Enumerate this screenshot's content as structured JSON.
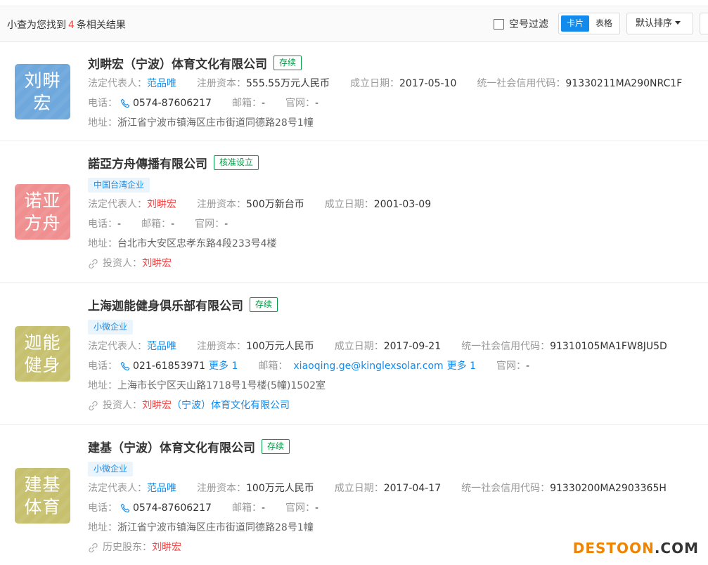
{
  "toolbar": {
    "result_prefix": "小查为您找到",
    "result_count": "4",
    "result_suffix": "条相关结果",
    "empty_filter_label": "空号过滤",
    "view_card_label": "卡片",
    "view_table_label": "表格",
    "sort_label": "默认排序"
  },
  "labels": {
    "legal_rep": "法定代表人：",
    "capital": "注册资本：",
    "founded": "成立日期：",
    "credit_code": "统一社会信用代码：",
    "phone": "电话：",
    "email": "邮箱：",
    "website": "官网：",
    "address": "地址：",
    "investor": "投资人：",
    "history_shareholder": "历史股东："
  },
  "results": [
    {
      "logo_line1": "刘畊",
      "logo_line2": "宏",
      "logo_color": "#6fa8dc",
      "name_highlight": "刘畊宏",
      "name_rest": "（宁波）体育文化有限公司",
      "status": "存续",
      "legal_rep": "范品唯",
      "capital": "555.55万元人民币",
      "founded": "2017-05-10",
      "credit_code": "91330211MA290NRC1F",
      "phone": "0574-87606217",
      "email": "-",
      "website": "-",
      "address": "浙江省宁波市镇海区庄市街道同德路28号1幢"
    },
    {
      "logo_line1": "诺亚",
      "logo_line2": "方舟",
      "logo_color": "#ef8f8f",
      "name": "諾亞方舟傳播有限公司",
      "status": "核准设立",
      "tag": "中国台湾企业",
      "legal_rep": "刘畊宏",
      "capital": "500万新台币",
      "founded": "2001-03-09",
      "phone": "-",
      "email": "-",
      "website": "-",
      "address": "台北市大安区忠孝东路4段233号4楼",
      "investor": "刘畊宏"
    },
    {
      "logo_line1": "迦能",
      "logo_line2": "健身",
      "logo_color": "#c6c06f",
      "name": "上海迦能健身俱乐部有限公司",
      "status": "存续",
      "tag": "小微企业",
      "legal_rep": "范品唯",
      "capital": "100万元人民币",
      "founded": "2017-09-21",
      "credit_code": "91310105MA1FW8JU5D",
      "phone": "021-61853971",
      "phone_more": "更多 1",
      "email": "xiaoqing.ge@kinglexsolar.com",
      "email_more": "更多 1",
      "website": "-",
      "address": "上海市长宁区天山路1718号1号楼(5幢)1502室",
      "investor_highlight": "刘畊宏",
      "investor_rest": "（宁波）体育文化有限公司"
    },
    {
      "logo_line1": "建基",
      "logo_line2": "体育",
      "logo_color": "#c6c06f",
      "name": "建基（宁波）体育文化有限公司",
      "status": "存续",
      "tag": "小微企业",
      "legal_rep": "范品唯",
      "capital": "100万元人民币",
      "founded": "2017-04-17",
      "credit_code": "91330200MA2903365H",
      "phone": "0574-87606217",
      "email": "-",
      "website": "-",
      "address": "浙江省宁波市镇海区庄市街道同德路28号1幢",
      "history_shareholder": "刘畊宏"
    }
  ],
  "watermark": {
    "part1": "DESTOON",
    "part2": ".COM"
  }
}
